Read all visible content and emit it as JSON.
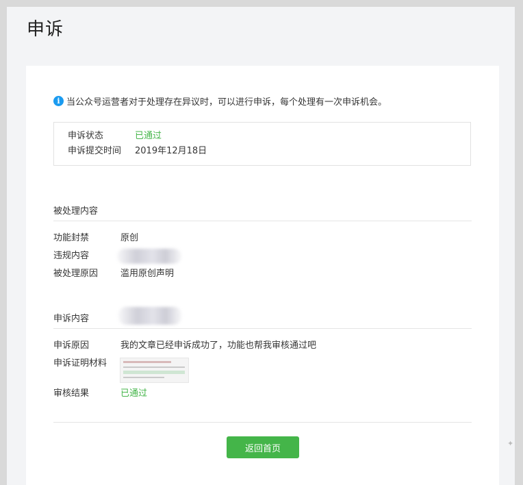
{
  "page": {
    "title": "申诉"
  },
  "notice": {
    "text": "当公众号运营者对于处理存在异议时，可以进行申诉，每个处理有一次申诉机会。"
  },
  "status": {
    "state_label": "申诉状态",
    "state_value": "已通过",
    "submit_time_label": "申诉提交时间",
    "submit_time_value": "2019年12月18日"
  },
  "processed": {
    "heading": "被处理内容",
    "function_ban_label": "功能封禁",
    "function_ban_value": "原创",
    "violation_label": "违规内容",
    "reason_label": "被处理原因",
    "reason_value": "滥用原创声明"
  },
  "appeal": {
    "heading": "申诉内容",
    "reason_label": "申诉原因",
    "reason_value": "我的文章已经申诉成功了，功能也帮我审核通过吧",
    "evidence_label": "申诉证明材料",
    "result_label": "审核结果",
    "result_value": "已通过"
  },
  "actions": {
    "back_label": "返回首页"
  },
  "colors": {
    "accent_green": "#44b549",
    "info_blue": "#1a9bf0"
  },
  "icons": {
    "notice": "info-icon",
    "corner": "pin-icon"
  }
}
